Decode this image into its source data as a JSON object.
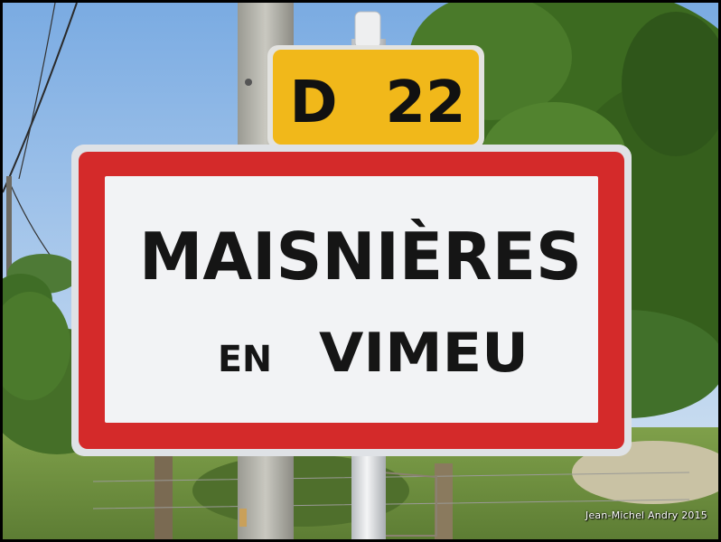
{
  "road_plate": {
    "letter": "D",
    "number": "22"
  },
  "town_sign": {
    "line1": "MAISNIÈRES",
    "line2_prefix": "EN",
    "line2_name": "VIMEU"
  },
  "credit": "Jean-Michel Andry 2015",
  "colors": {
    "sign_border": "#d42a2a",
    "sign_face": "#f2f3f5",
    "road_plate": "#f1b81a",
    "foliage": "#3e6f22"
  }
}
